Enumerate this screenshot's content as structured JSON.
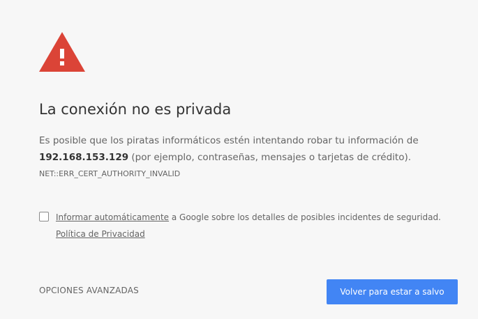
{
  "icon": "warning-triangle-icon",
  "colors": {
    "background": "#f7f7f7",
    "warning_red": "#db4437",
    "primary_blue": "#4285f4"
  },
  "title": "La conexión no es privada",
  "description": {
    "text_before": "Es posible que los piratas informáticos estén intentando robar tu información de ",
    "host": "192.168.153.129",
    "text_after": " (por ejemplo, contraseñas, mensajes o tarjetas de crédito)."
  },
  "error_code": "NET::ERR_CERT_AUTHORITY_INVALID",
  "report": {
    "checked": false,
    "link_text": "Informar automáticamente",
    "text": " a Google sobre los detalles de posibles incidentes de seguridad. ",
    "privacy_link": "Política de Privacidad"
  },
  "buttons": {
    "advanced": "OPCIONES AVANZADAS",
    "back_to_safety": "Volver para estar a salvo"
  }
}
